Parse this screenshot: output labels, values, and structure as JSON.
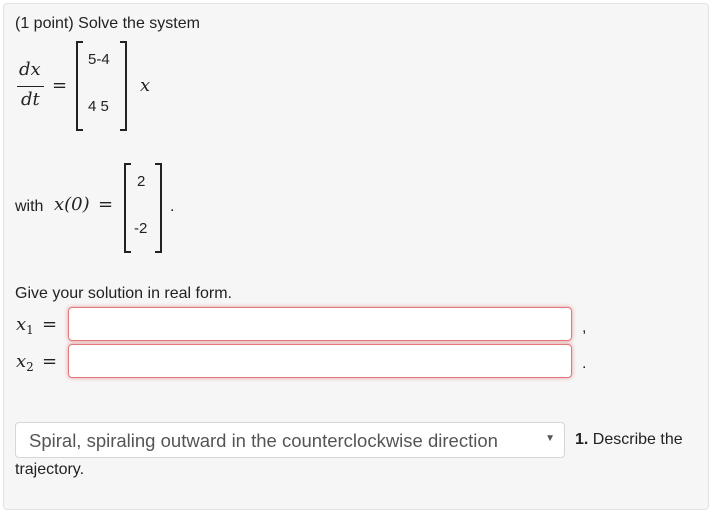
{
  "problem": {
    "header": "(1 point) Solve the system",
    "deriv_num": "dx",
    "deriv_den": "dt",
    "equals": "=",
    "matrix": {
      "row1": "5-4",
      "row2": "4 5"
    },
    "var_x": "x",
    "initial_prefix": "with",
    "initial_lhs": "x(0)",
    "initial_vector": {
      "row1": "2",
      "row2": "-2"
    },
    "initial_period": ".",
    "instructions": "Give your solution in real form."
  },
  "answers": {
    "x1": {
      "var": "x",
      "sub": "1",
      "value": "",
      "trailing": ","
    },
    "x2": {
      "var": "x",
      "sub": "2",
      "value": "",
      "trailing": "."
    }
  },
  "trajectory": {
    "selected": "Spiral, spiraling outward in the counterclockwise direction",
    "question_number": "1.",
    "question_text": "Describe the",
    "question_continued": "trajectory."
  },
  "icons": {
    "dropdown": "chevron-down-icon"
  }
}
